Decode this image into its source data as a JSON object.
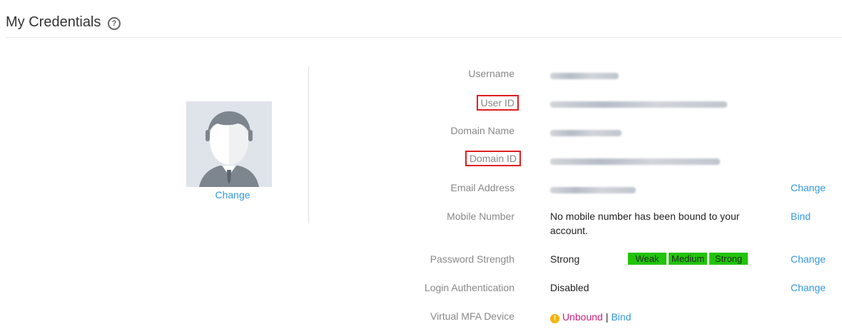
{
  "header": {
    "title": "My Credentials",
    "help_icon": "question-circle-icon"
  },
  "avatar": {
    "icon": "user-silhouette-icon",
    "change_label": "Change"
  },
  "fields": {
    "username": {
      "label": "Username",
      "value": ""
    },
    "user_id": {
      "label": "User ID",
      "value": ""
    },
    "domain_name": {
      "label": "Domain Name",
      "value": ""
    },
    "domain_id": {
      "label": "Domain ID",
      "value": ""
    },
    "email": {
      "label": "Email Address",
      "value": "",
      "action": "Change"
    },
    "mobile": {
      "label": "Mobile Number",
      "value": "No mobile number has been bound to your account.",
      "action": "Bind"
    },
    "password_strength": {
      "label": "Password Strength",
      "value": "Strong",
      "levels": [
        "Weak",
        "Medium",
        "Strong"
      ],
      "action": "Change"
    },
    "login_auth": {
      "label": "Login Authentication",
      "value": "Disabled",
      "action": "Change"
    },
    "mfa": {
      "label": "Virtual MFA Device",
      "status": "Unbound",
      "separator": "|",
      "bind": "Bind",
      "icon": "warning-icon"
    }
  },
  "colors": {
    "accent": "#3399dd",
    "highlight_border": "#e02020",
    "strength_green": "#22c40a",
    "unbound": "#cc2277"
  }
}
